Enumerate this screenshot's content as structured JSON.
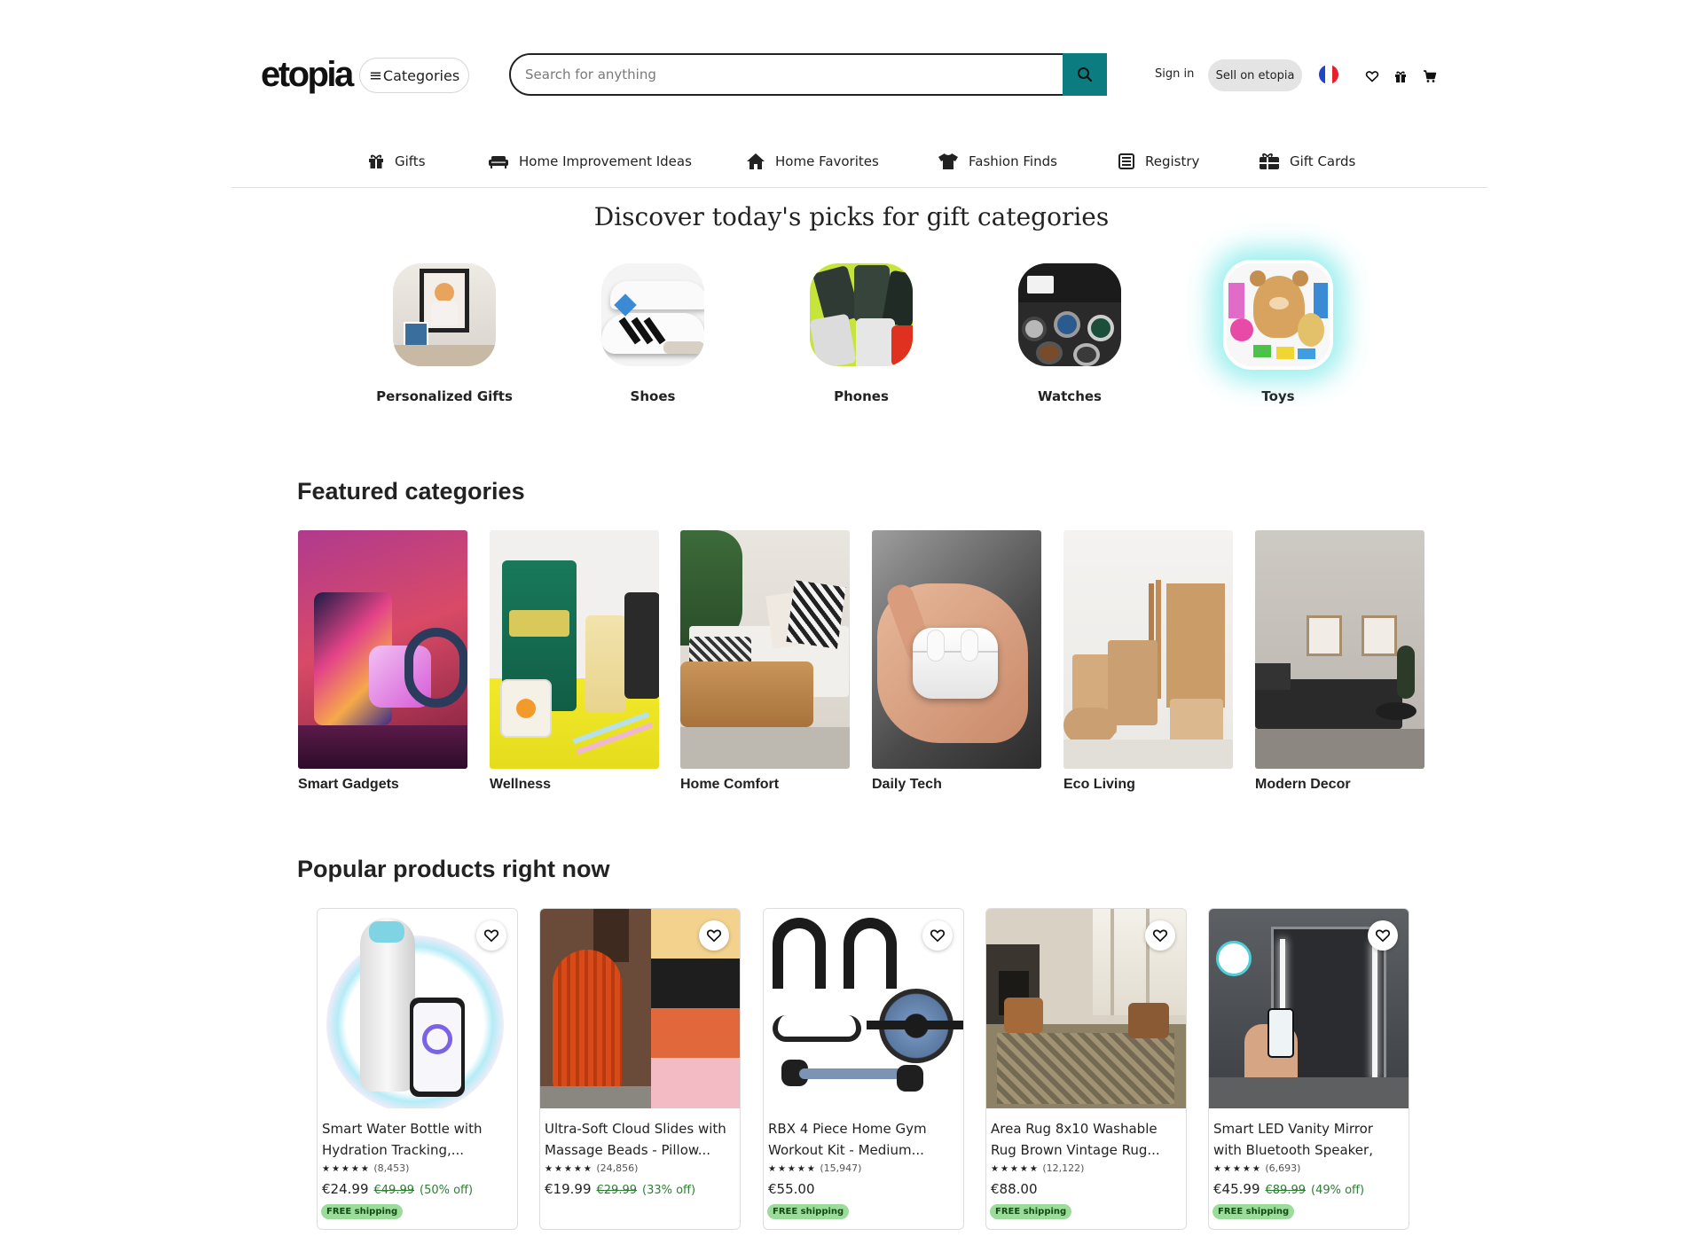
{
  "header": {
    "logo": "etopia",
    "categories_label": "Categories",
    "search_placeholder": "Search for anything",
    "sign_in": "Sign in",
    "sell": "Sell on etopia"
  },
  "nav": {
    "items": [
      {
        "label": "Gifts",
        "icon": "gift-icon"
      },
      {
        "label": "Home Improvement Ideas",
        "icon": "sofa-icon"
      },
      {
        "label": "Home Favorites",
        "icon": "home-icon"
      },
      {
        "label": "Fashion Finds",
        "icon": "shirt-icon"
      },
      {
        "label": "Registry",
        "icon": "registry-icon"
      },
      {
        "label": "Gift Cards",
        "icon": "gift-card-icon"
      }
    ]
  },
  "discover": {
    "title": "Discover today's picks for gift categories",
    "picks": [
      {
        "label": "Personalized Gifts"
      },
      {
        "label": "Shoes"
      },
      {
        "label": "Phones"
      },
      {
        "label": "Watches"
      },
      {
        "label": "Toys"
      }
    ]
  },
  "featured": {
    "title": "Featured categories",
    "items": [
      {
        "label": "Smart Gadgets"
      },
      {
        "label": "Wellness"
      },
      {
        "label": "Home Comfort"
      },
      {
        "label": "Daily Tech"
      },
      {
        "label": "Eco Living"
      },
      {
        "label": "Modern Decor"
      }
    ]
  },
  "popular": {
    "title": "Popular products right now",
    "products": [
      {
        "title": "Smart Water Bottle with Hydration Tracking,...",
        "stars": "★★★★★",
        "reviews": "(8,453)",
        "price": "€24.99",
        "old_price": "€49.99",
        "discount": "(50% off)",
        "shipping": "FREE shipping"
      },
      {
        "title": "Ultra-Soft Cloud Slides with Massage Beads - Pillow...",
        "stars": "★★★★★",
        "reviews": "(24,856)",
        "price": "€19.99",
        "old_price": "€29.99",
        "discount": "(33% off)",
        "shipping": ""
      },
      {
        "title": "RBX 4 Piece Home Gym Workout Kit - Medium...",
        "stars": "★★★★★",
        "reviews": "(15,947)",
        "price": "€55.00",
        "old_price": "",
        "discount": "",
        "shipping": "FREE shipping"
      },
      {
        "title": "Area Rug 8x10 Washable Rug Brown Vintage Rug...",
        "stars": "★★★★★",
        "reviews": "(12,122)",
        "price": "€88.00",
        "old_price": "",
        "discount": "",
        "shipping": "FREE shipping"
      },
      {
        "title": "Smart LED Vanity Mirror with Bluetooth Speaker, Phone...",
        "stars": "★★★★★",
        "reviews": "(6,693)",
        "price": "€45.99",
        "old_price": "€89.99",
        "discount": "(49% off)",
        "shipping": "FREE shipping"
      }
    ]
  },
  "colors": {
    "accent": "#0b7d80",
    "free_shipping_bg": "#9bdc9b",
    "discount_green": "#2e7d32"
  }
}
